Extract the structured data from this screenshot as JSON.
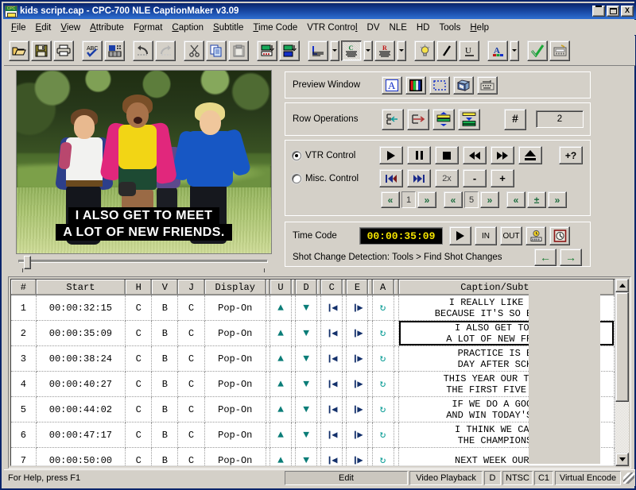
{
  "window": {
    "title": "kids script.cap - CPC-700 NLE CaptionMaker v3.09",
    "app_icon": "cpc-logo-icon",
    "minimize_label": "_",
    "maximize_label": "",
    "close_label": "X"
  },
  "menubar": {
    "items": [
      {
        "label": "File",
        "accel": "F"
      },
      {
        "label": "Edit",
        "accel": "E"
      },
      {
        "label": "View",
        "accel": "V"
      },
      {
        "label": "Attribute",
        "accel": "A"
      },
      {
        "label": "Format",
        "accel": "o"
      },
      {
        "label": "Caption",
        "accel": "C"
      },
      {
        "label": "Subtitle",
        "accel": "S"
      },
      {
        "label": "Time Code",
        "accel": "T"
      },
      {
        "label": "VTR Control",
        "accel": "l"
      },
      {
        "label": "DV",
        "accel": ""
      },
      {
        "label": "NLE",
        "accel": ""
      },
      {
        "label": "HD",
        "accel": ""
      },
      {
        "label": "Tools",
        "accel": ""
      },
      {
        "label": "Help",
        "accel": "H"
      }
    ]
  },
  "toolbar": {
    "buttons": [
      {
        "name": "open-file-button",
        "icon": "open-folder-icon"
      },
      {
        "name": "save-file-button",
        "icon": "floppy-disk-icon"
      },
      {
        "name": "print-button",
        "icon": "printer-icon"
      },
      {
        "name": "spell-check-button",
        "icon": "abc-check-icon"
      },
      {
        "name": "preview-grid-button",
        "icon": "preview-grid-icon"
      },
      {
        "name": "undo-button",
        "icon": "undo-arrow-icon"
      },
      {
        "name": "redo-button",
        "icon": "redo-arrow-icon"
      },
      {
        "name": "cut-button",
        "icon": "scissors-icon"
      },
      {
        "name": "copy-button",
        "icon": "copy-pages-icon"
      },
      {
        "name": "paste-button",
        "icon": "clipboard-icon"
      },
      {
        "name": "insert-row-below-button",
        "icon": "row-insert-down-icon"
      },
      {
        "name": "split-row-button",
        "icon": "row-split-icon"
      },
      {
        "name": "align-left-button",
        "icon": "align-left-icon"
      },
      {
        "name": "align-center-button",
        "icon": "align-center-icon"
      },
      {
        "name": "align-right-button",
        "icon": "align-right-icon"
      },
      {
        "name": "hint-button",
        "icon": "lightbulb-icon"
      },
      {
        "name": "italic-button",
        "icon": "italic-icon"
      },
      {
        "name": "underline-button",
        "icon": "underline-icon"
      },
      {
        "name": "font-color-button",
        "icon": "font-color-icon"
      },
      {
        "name": "check-button",
        "icon": "green-check-icon"
      },
      {
        "name": "encode-button",
        "icon": "encoder-icon"
      }
    ]
  },
  "preview": {
    "caption_line1": "I ALSO GET TO MEET",
    "caption_line2": "A LOT OF NEW FRIENDS."
  },
  "preview_window": {
    "label": "Preview Window",
    "buttons": [
      {
        "name": "text-preview-button",
        "icon": "letter-a-boxed-icon"
      },
      {
        "name": "color-bars-button",
        "icon": "color-bars-icon"
      },
      {
        "name": "safe-area-button",
        "icon": "dotted-rectangle-icon"
      },
      {
        "name": "3d-preview-button",
        "icon": "3d-box-icon"
      },
      {
        "name": "keyboard-preview-button",
        "icon": "keyboard-icon"
      }
    ]
  },
  "row_operations": {
    "label": "Row Operations",
    "buttons": [
      {
        "name": "merge-rows-button",
        "icon": "merge-rows-icon"
      },
      {
        "name": "split-rows-button",
        "icon": "split-rows-icon"
      },
      {
        "name": "distribute-rows-button",
        "icon": "distribute-rows-icon"
      },
      {
        "name": "collapse-rows-button",
        "icon": "collapse-rows-icon"
      },
      {
        "name": "row-count-button",
        "icon": "hash-icon"
      }
    ],
    "count_value": "2"
  },
  "vtr": {
    "vtr_control_label": "VTR Control",
    "misc_control_label": "Misc. Control",
    "selected": "VTR Control",
    "transport": [
      {
        "name": "play-button",
        "icon": "play-icon"
      },
      {
        "name": "pause-button",
        "icon": "pause-icon"
      },
      {
        "name": "stop-button",
        "icon": "stop-icon"
      },
      {
        "name": "rewind-button",
        "icon": "rewind-icon"
      },
      {
        "name": "fast-forward-button",
        "icon": "fast-forward-icon"
      },
      {
        "name": "eject-button",
        "icon": "eject-icon"
      }
    ],
    "help_button": {
      "name": "vtr-help-button",
      "label": "+?"
    },
    "misc_row": [
      {
        "name": "skip-start-button",
        "icon": "skip-to-start-icon"
      },
      {
        "name": "skip-end-button",
        "icon": "skip-to-end-icon"
      },
      {
        "name": "speed-button",
        "label": "2x"
      },
      {
        "name": "decrement-button",
        "label": "-"
      },
      {
        "name": "increment-button",
        "label": "+"
      }
    ],
    "nav_row": [
      {
        "name": "step-back-1-button",
        "label": "«"
      },
      {
        "name": "step-field-1",
        "value": "1"
      },
      {
        "name": "step-fwd-1-button",
        "label": "»"
      },
      {
        "name": "step-back-5-button",
        "label": "«"
      },
      {
        "name": "step-field-5",
        "value": "5"
      },
      {
        "name": "step-fwd-5-button",
        "label": "»"
      },
      {
        "name": "jump-back-button",
        "label": "«"
      },
      {
        "name": "plus-minus-button",
        "label": "±"
      },
      {
        "name": "jump-fwd-button",
        "label": "»"
      }
    ]
  },
  "timecode": {
    "label": "Time Code",
    "value": "00:00:35:09",
    "play_button": {
      "name": "timecode-play-button",
      "icon": "play-icon"
    },
    "in_label": "IN",
    "out_label": "OUT",
    "buttons": [
      {
        "name": "timecode-reader-button",
        "icon": "timecode-reader-icon"
      },
      {
        "name": "timecode-clock-button",
        "icon": "clock-icon"
      }
    ],
    "shot_change_text": "Shot Change Detection: Tools > Find Shot Changes",
    "prev_shot_label": "←",
    "next_shot_label": "→"
  },
  "grid": {
    "columns": [
      "#",
      "Start",
      "H",
      "V",
      "J",
      "Display",
      "U",
      "D",
      "C",
      "E",
      "A",
      "Caption/Subtitle"
    ],
    "selected_row": 2,
    "rows": [
      {
        "num": "1",
        "start": "00:00:32:15",
        "h": "C",
        "v": "B",
        "j": "C",
        "display": "Pop-On",
        "caption": "I REALLY LIKE SOCCER\nBECAUSE IT'S SO EXCITING."
      },
      {
        "num": "2",
        "start": "00:00:35:09",
        "h": "C",
        "v": "B",
        "j": "C",
        "display": "Pop-On",
        "caption": "I ALSO GET TO MEET\nA LOT OF NEW FRIENDS."
      },
      {
        "num": "3",
        "start": "00:00:38:24",
        "h": "C",
        "v": "B",
        "j": "C",
        "display": "Pop-On",
        "caption": "PRACTICE IS EVERY\nDAY AFTER SCHOOL."
      },
      {
        "num": "4",
        "start": "00:00:40:27",
        "h": "C",
        "v": "B",
        "j": "C",
        "display": "Pop-On",
        "caption": "THIS YEAR OUR TEAM WON\nTHE FIRST FIVE GAMES."
      },
      {
        "num": "5",
        "start": "00:00:44:02",
        "h": "C",
        "v": "B",
        "j": "C",
        "display": "Pop-On",
        "caption": "IF WE DO A GOOD JOB\nAND WIN TODAY'S GAME,"
      },
      {
        "num": "6",
        "start": "00:00:47:17",
        "h": "C",
        "v": "B",
        "j": "C",
        "display": "Pop-On",
        "caption": "I THINK WE CAN WIN\nTHE CHAMPIONSHIP."
      },
      {
        "num": "7",
        "start": "00:00:50:00",
        "h": "C",
        "v": "B",
        "j": "C",
        "display": "Pop-On",
        "caption": "NEXT WEEK OUR GAME"
      }
    ],
    "row_icons": {
      "up": "▲",
      "down": "▼",
      "c": "❙◀",
      "e": "❙▶",
      "a": "↻"
    }
  },
  "statusbar": {
    "message": "For Help, press F1",
    "panes": [
      "Edit",
      "Video Playback",
      "D",
      "NTSC",
      "C1",
      "Virtual Encode"
    ]
  },
  "colors": {
    "title_bar": "#0a246a",
    "face": "#d4d0c8",
    "timecode_text": "#f5e400",
    "grid_icon_teal": "#0b7d78",
    "grid_icon_navy": "#13306b",
    "nav_green": "#1a6b3c"
  }
}
